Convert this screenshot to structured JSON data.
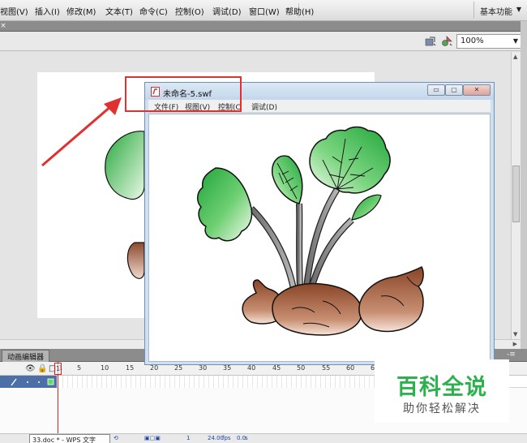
{
  "menubar": {
    "items": [
      "视图(V)",
      "插入(I)",
      "修改(M)",
      "文本(T)",
      "命令(C)",
      "控制(O)",
      "调试(D)",
      "窗口(W)",
      "帮助(H)"
    ],
    "workspace": "基本功能"
  },
  "editbar": {
    "zoom": "100%"
  },
  "timeline": {
    "tab_label": "动画编辑器",
    "frame_numbers": [
      "1",
      "5",
      "10",
      "15",
      "20",
      "25",
      "30",
      "35",
      "40",
      "45",
      "50",
      "55",
      "60",
      "65"
    ],
    "fps": "24.00",
    "fps_unit": "fps",
    "time": "0.0",
    "time_unit": "s",
    "current_frame": "1"
  },
  "swf_window": {
    "title": "未命名-5.swf",
    "menu": [
      "文件(F)",
      "视图(V)",
      "控制(C",
      "调试(D)"
    ]
  },
  "taskbar_tip": "33.doc * - WPS 文字",
  "watermark": {
    "title": "百科全说",
    "subtitle": "助你轻松解决"
  },
  "colors": {
    "highlight": "#e03030",
    "leaf_green": "#22b04a",
    "tuber_brown": "#8b4a2e",
    "watermark_green": "#2bb24c"
  }
}
